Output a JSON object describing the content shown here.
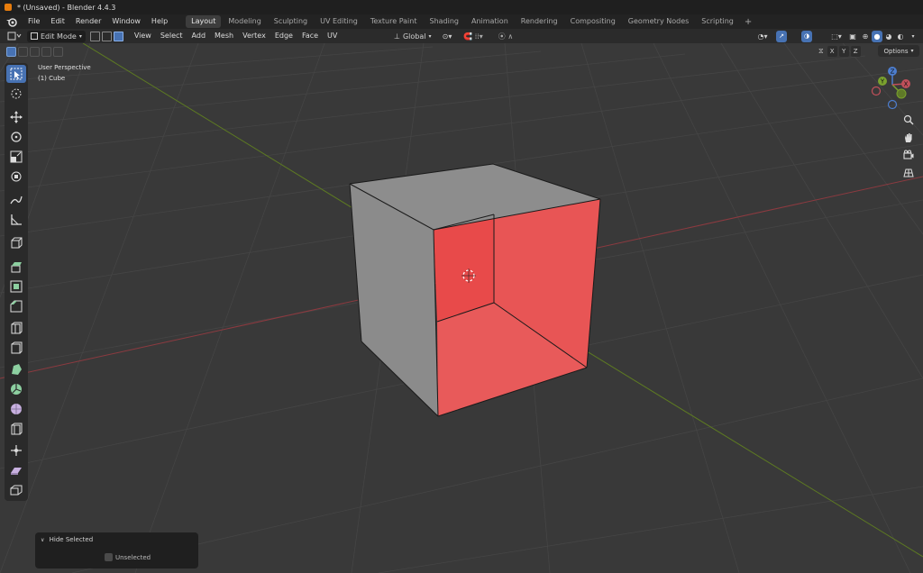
{
  "window": {
    "title": "* (Unsaved) - Blender 4.4.3"
  },
  "top_menu": [
    "File",
    "Edit",
    "Render",
    "Window",
    "Help"
  ],
  "workspaces": {
    "tabs": [
      "Layout",
      "Modeling",
      "Sculpting",
      "UV Editing",
      "Texture Paint",
      "Shading",
      "Animation",
      "Rendering",
      "Compositing",
      "Geometry Nodes",
      "Scripting"
    ],
    "active": "Layout",
    "add_label": "+"
  },
  "header": {
    "mode": "Edit Mode",
    "menus": [
      "View",
      "Select",
      "Add",
      "Mesh",
      "Vertex",
      "Edge",
      "Face",
      "UV"
    ],
    "transform_orientation": "Global"
  },
  "viewport": {
    "view_name": "User Perspective",
    "object_name": "(1) Cube",
    "axes": [
      "X",
      "Y",
      "Z"
    ],
    "options_label": "Options",
    "gizmo_labels": {
      "z": "Z",
      "y": "Y",
      "x": "X"
    }
  },
  "operator_panel": {
    "title": "Hide Selected",
    "checkbox_label": "Unselected"
  },
  "colors": {
    "accent": "#4772b3",
    "selected_face": "#e84a4a",
    "mesh_face": "#8c8c8c",
    "x_axis": "#c0505a",
    "y_axis": "#7aa12e"
  },
  "icons": {
    "toolbar": [
      "select-box-icon",
      "cursor-icon",
      "move-icon",
      "rotate-icon",
      "scale-icon",
      "transform-icon",
      "annotate-icon",
      "measure-icon",
      "add-cube-icon",
      "extrude-icon",
      "inset-icon",
      "bevel-icon",
      "loop-cut-icon",
      "knife-icon",
      "poly-build-icon",
      "spin-icon",
      "smooth-icon",
      "edge-slide-icon",
      "shrink-fatten-icon",
      "shear-icon",
      "rip-icon"
    ]
  }
}
